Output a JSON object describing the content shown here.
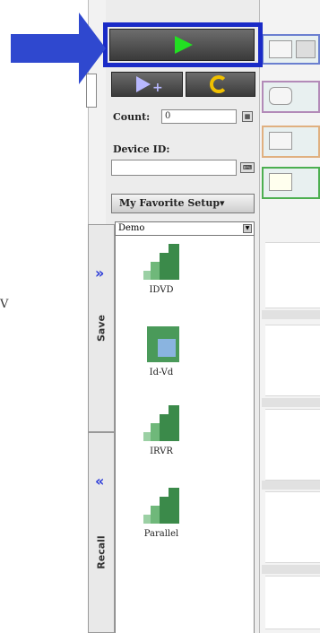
{
  "count": {
    "label": "Count:",
    "value": "0"
  },
  "device_id": {
    "label": "Device ID:",
    "value": ""
  },
  "favorite": {
    "label": "My Favorite Setup▾"
  },
  "setup_select": {
    "value": "Demo"
  },
  "side_tabs": {
    "save": "Save",
    "recall": "Recall",
    "expand": "»",
    "collapse": "«"
  },
  "items": [
    {
      "label": "IDVD",
      "icon": "idvd-icon"
    },
    {
      "label": "Id-Vd",
      "icon": "id-vd-icon"
    },
    {
      "label": "IRVR",
      "icon": "irvr-icon"
    },
    {
      "label": "Parallel",
      "icon": "parallel-icon"
    }
  ],
  "margin_text": "V",
  "colors": {
    "highlight": "#1a2bc7",
    "arrow": "#2f48cf",
    "play": "#22e022",
    "repeat": "#f0c000"
  }
}
